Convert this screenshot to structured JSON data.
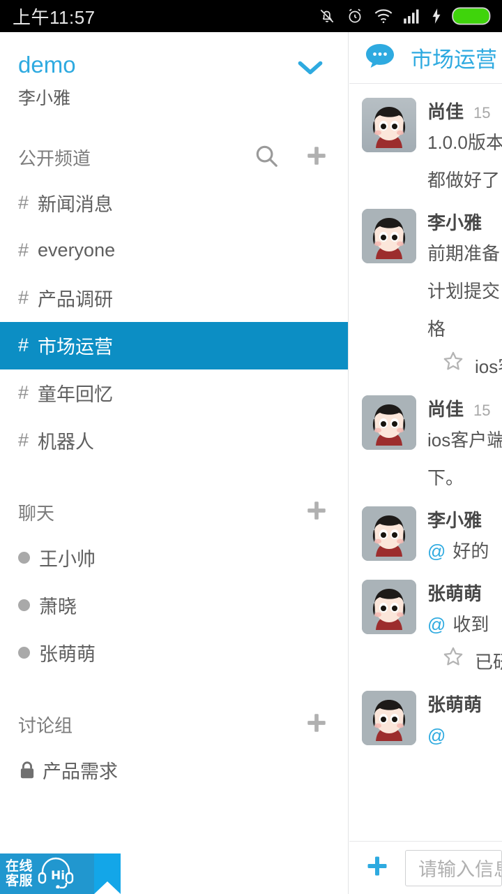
{
  "statusbar": {
    "time": "上午11:57",
    "icons": [
      "mute-bell-icon",
      "alarm-clock-icon",
      "wifi-icon",
      "signal-bars-icon",
      "charging-bolt-icon",
      "battery-icon"
    ]
  },
  "sidebar": {
    "team_name": "demo",
    "user_name": "李小雅",
    "expand_icon": "chevron-down-icon",
    "sections": [
      {
        "title": "公开频道",
        "actions": [
          "search-icon",
          "plus-icon"
        ],
        "items": [
          {
            "prefix": "#",
            "label": "新闻消息",
            "active": false
          },
          {
            "prefix": "#",
            "label": "everyone",
            "active": false
          },
          {
            "prefix": "#",
            "label": "产品调研",
            "active": false
          },
          {
            "prefix": "#",
            "label": "市场运营",
            "active": true
          },
          {
            "prefix": "#",
            "label": "童年回忆",
            "active": false
          },
          {
            "prefix": "#",
            "label": "机器人",
            "active": false
          }
        ]
      },
      {
        "title": "聊天",
        "actions": [
          "plus-icon"
        ],
        "items": [
          {
            "prefix": "dot",
            "label": "王小帅",
            "active": false
          },
          {
            "prefix": "dot",
            "label": "萧晓",
            "active": false
          },
          {
            "prefix": "dot",
            "label": "张萌萌",
            "active": false
          }
        ]
      },
      {
        "title": "讨论组",
        "actions": [
          "plus-icon"
        ],
        "items": [
          {
            "prefix": "lock",
            "label": "产品需求",
            "active": false
          }
        ]
      }
    ]
  },
  "customer_service": {
    "line1": "在线",
    "line2": "客服",
    "icon": "headset-hi-icon",
    "badge_color": "#2197cf"
  },
  "chat": {
    "header_icon": "speech-bubble-icon",
    "title": "市场运营",
    "messages": [
      {
        "author": "尚佳",
        "time": "15",
        "lines": [
          {
            "text": "1.0.0版本",
            "starred": false,
            "mention": false
          },
          {
            "text": "都做好了",
            "starred": false,
            "mention": false
          }
        ]
      },
      {
        "author": "李小雅",
        "time": "",
        "lines": [
          {
            "text": "前期准备",
            "starred": false,
            "mention": false
          },
          {
            "text": "计划提交",
            "starred": false,
            "mention": false
          },
          {
            "text": "格",
            "starred": false,
            "mention": false
          },
          {
            "text": "ios客户端",
            "starred": true,
            "mention": false
          }
        ]
      },
      {
        "author": "尚佳",
        "time": "15",
        "lines": [
          {
            "text": "ios客户端",
            "starred": false,
            "mention": false
          },
          {
            "text": "下。",
            "starred": false,
            "mention": false
          }
        ]
      },
      {
        "author": "李小雅",
        "time": "",
        "lines": [
          {
            "text": "好的",
            "starred": false,
            "mention": true
          }
        ]
      },
      {
        "author": "张萌萌",
        "time": "",
        "lines": [
          {
            "text": "收到",
            "starred": false,
            "mention": true
          },
          {
            "text": "已研究，",
            "starred": true,
            "mention": false
          }
        ]
      },
      {
        "author": "张萌萌",
        "time": "",
        "lines": [
          {
            "text": "",
            "starred": false,
            "mention": true
          }
        ]
      }
    ]
  },
  "composer": {
    "add_icon": "plus-icon",
    "placeholder": "请输入信息"
  },
  "colors": {
    "accent": "#2eaae0",
    "active_row": "#0c8ec4",
    "text": "#5f5f5f",
    "muted": "#a7a7a7"
  }
}
